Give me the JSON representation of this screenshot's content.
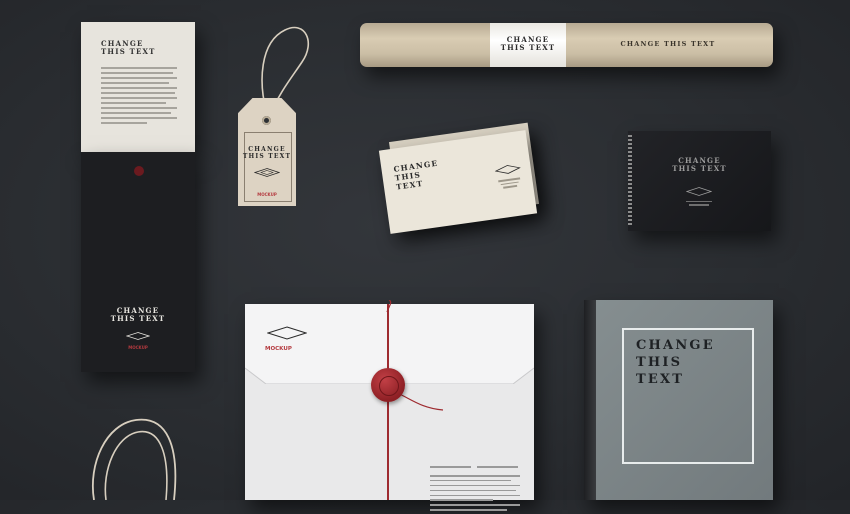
{
  "scene": {
    "background_color": "#2d3034",
    "accent_color": "#a3262c"
  },
  "letter": {
    "title": "CHANGE\nTHIS TEXT"
  },
  "folder": {
    "title": "CHANGE\nTHIS TEXT",
    "sub": "MOCKUP"
  },
  "tag": {
    "title": "CHANGE\nTHIS TEXT",
    "sub": "MOCKUP"
  },
  "tube": {
    "band_title": "CHANGE\nTHIS TEXT",
    "right_title": "CHANGE THIS TEXT"
  },
  "business_cards": {
    "title": "CHANGE\nTHIS\nTEXT"
  },
  "notebook": {
    "title": "CHANGE\nTHIS TEXT"
  },
  "envelope": {
    "sub": "MOCKUP"
  },
  "book": {
    "title": "CHANGE\nTHIS\nTEXT"
  }
}
